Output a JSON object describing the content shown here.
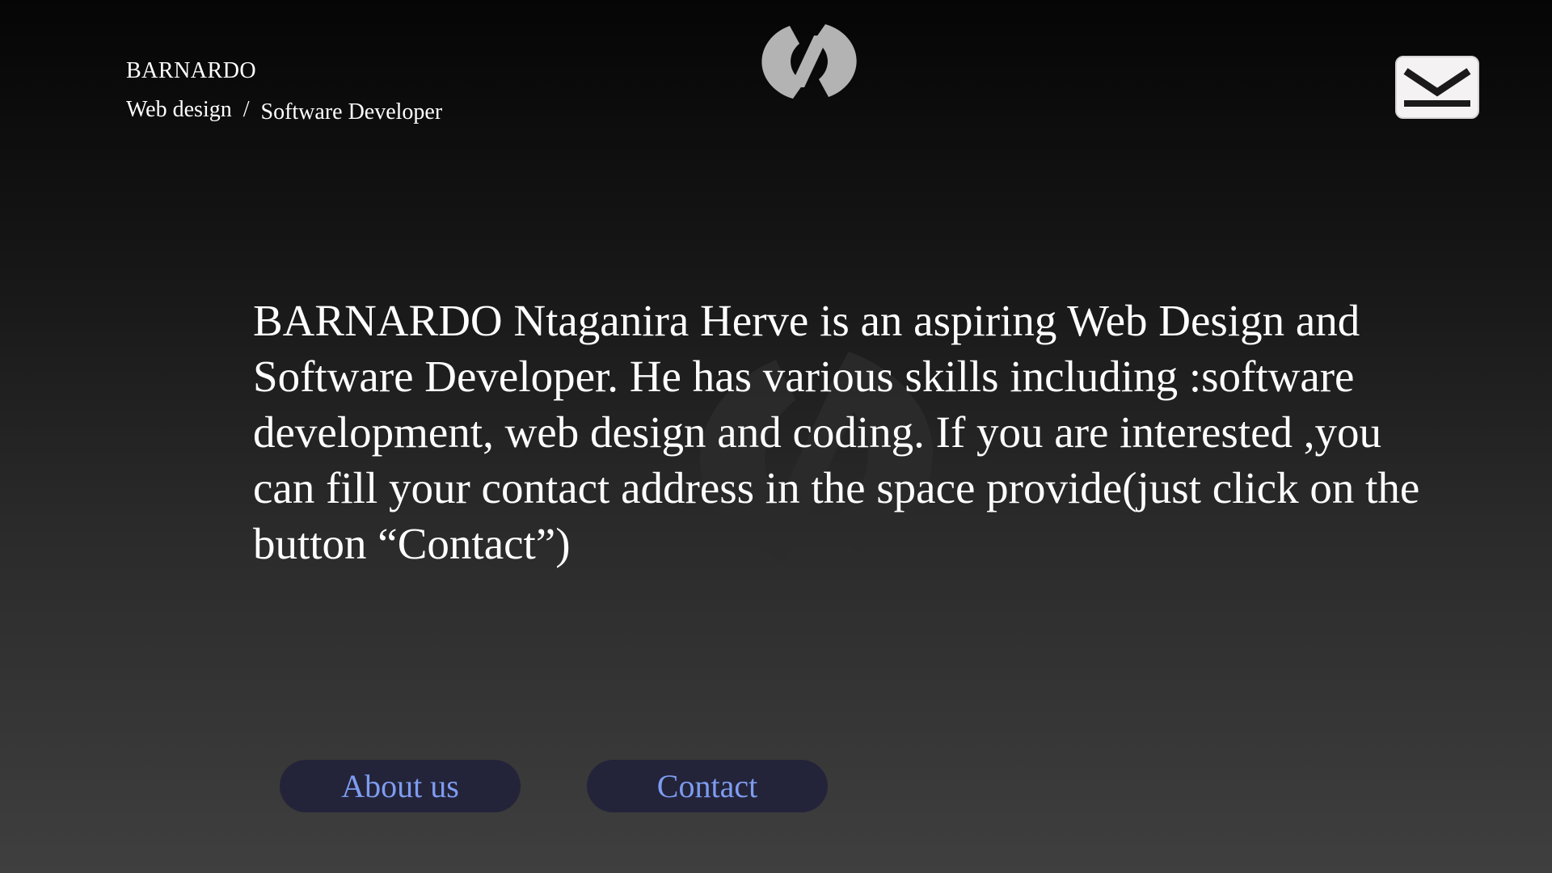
{
  "header": {
    "brand": "BARNARDO",
    "tagline": {
      "role1": "Web design",
      "separator": "/",
      "role2": "Software Developer"
    },
    "logo_icon": "hz-monogram-logo",
    "mail_icon": "envelope-icon"
  },
  "main": {
    "intro_text": "BARNARDO Ntaganira Herve is an aspiring Web Design and Software Developer. He has various skills including :software development, web design and coding. If you are interested ,you can fill your contact address in  the space provide(just click on the button “Contact”)"
  },
  "actions": {
    "about_label": "About us",
    "contact_label": "Contact"
  },
  "colors": {
    "background_top": "#050505",
    "background_bottom": "#3f3f3f",
    "logo": "#b3b3b3",
    "button_bg": "#23243a",
    "button_text": "#7e9cf0"
  }
}
